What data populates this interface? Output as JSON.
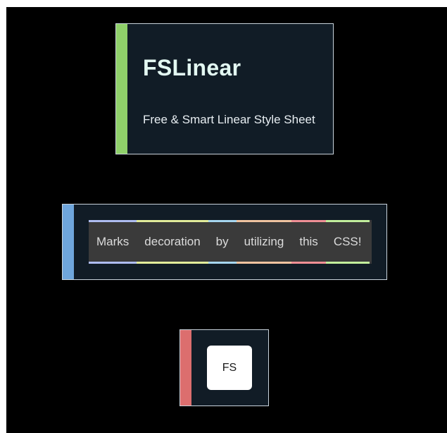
{
  "colors": {
    "background": "#000000",
    "card_bg": "#111c26",
    "card_border": "#c9d3dc",
    "stripe_green": "#8fd06a",
    "stripe_blue": "#6fa6dc",
    "stripe_red": "#dc6e6e"
  },
  "hero": {
    "title": "FSLinear",
    "subtitle": "Free & Smart Linear Style Sheet"
  },
  "marks": {
    "words": [
      {
        "text": "Marks",
        "color": "#aebcf0"
      },
      {
        "text": "decoration",
        "color": "#e2ec9a"
      },
      {
        "text": "by",
        "color": "#a6d6ef"
      },
      {
        "text": "utilizing",
        "color": "#f0c3a0"
      },
      {
        "text": "this",
        "color": "#ef8f95"
      },
      {
        "text": "CSS!",
        "color": "#c2ee9c"
      }
    ]
  },
  "badge": {
    "label": "FS"
  }
}
